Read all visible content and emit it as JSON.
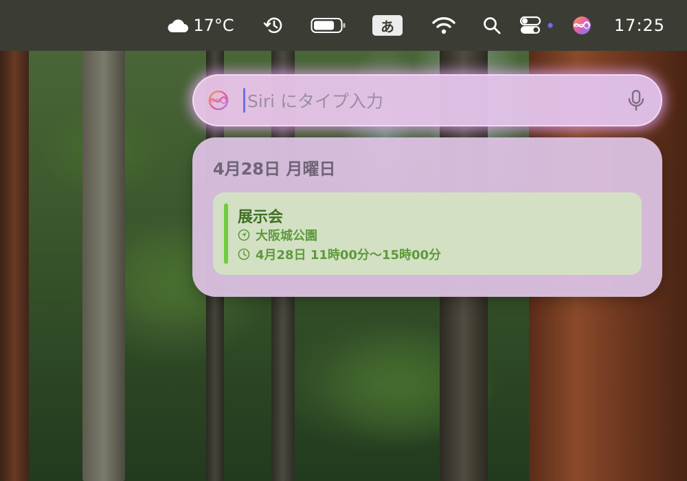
{
  "menubar": {
    "weather_icon": "cloud-icon",
    "temperature": "17°C",
    "history_icon": "clock-history-icon",
    "battery_icon": "battery-icon",
    "input_method": "あ",
    "wifi_icon": "wifi-icon",
    "search_icon": "search-icon",
    "control_center_icon": "control-center-icon",
    "siri_icon": "siri-icon",
    "clock": "17:25"
  },
  "siri": {
    "placeholder": "Siri にタイプ入力",
    "value": "",
    "mic_icon": "microphone-icon"
  },
  "calendar": {
    "date": "4月28日 月曜日",
    "event": {
      "title": "展示会",
      "location": "大阪城公園",
      "time": "4月28日 11時00分〜15時00分",
      "color": "#72cc3e"
    }
  },
  "colors": {
    "menubar": "#3b3d35",
    "siri_glow": "#ecaaff",
    "card": "#dac0e0",
    "event_bg": "#d3e0c4",
    "event_text": "#3f6f24"
  }
}
